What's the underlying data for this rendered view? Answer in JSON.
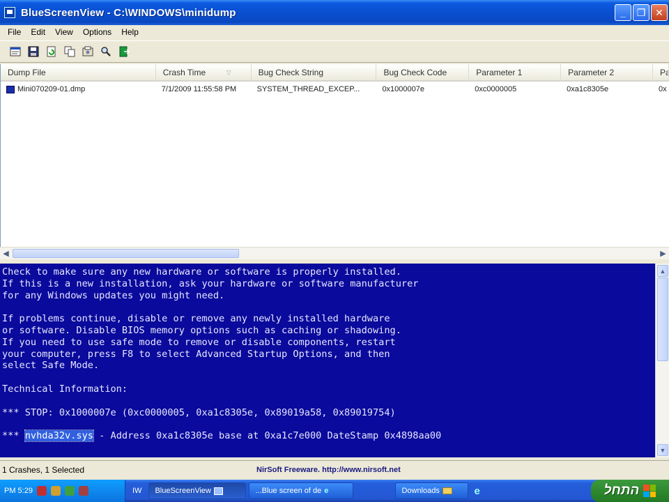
{
  "window": {
    "title": "BlueScreenView  -  C:\\WINDOWS\\minidump",
    "minimize": "_",
    "maximize": "❐",
    "close": "✕"
  },
  "menu": [
    "File",
    "Edit",
    "View",
    "Options",
    "Help"
  ],
  "toolbar": {
    "icons": [
      "properties-icon",
      "save-icon",
      "refresh-icon",
      "copy-icon",
      "options-icon",
      "find-icon",
      "exit-icon"
    ]
  },
  "list": {
    "columns": [
      "Dump File",
      "Crash Time",
      "Bug Check String",
      "Bug Check Code",
      "Parameter 1",
      "Parameter 2",
      "Pa"
    ],
    "rows": [
      [
        "Mini070209-01.dmp",
        "7/1/2009 11:55:58 PM",
        "SYSTEM_THREAD_EXCEP...",
        "0x1000007e",
        "0xc0000005",
        "0xa1c8305e",
        "0x"
      ]
    ]
  },
  "bsod": {
    "lines": [
      "Check to make sure any new hardware or software is properly installed.",
      "If this is a new installation, ask your hardware or software manufacturer",
      "for any Windows updates you might need.",
      "",
      "If problems continue, disable or remove any newly installed hardware",
      "or software. Disable BIOS memory options such as caching or shadowing.",
      "If you need to use safe mode to remove or disable components, restart",
      "your computer, press F8 to select Advanced Startup Options, and then",
      "select Safe Mode.",
      "",
      "Technical Information:",
      "",
      "*** STOP: 0x1000007e (0xc0000005, 0xa1c8305e, 0x89019a58, 0x89019754)",
      ""
    ],
    "driver_prefix": "*** ",
    "driver_name": "nvhda32v.sys",
    "driver_suffix": " - Address 0xa1c8305e base at 0xa1c7e000 DateStamp 0x4898aa00"
  },
  "status": {
    "count": "1 Crashes, 1 Selected",
    "link": "NirSoft Freeware.  http://www.nirsoft.net"
  },
  "taskbar": {
    "clock": "PM 5:29",
    "lang": "IW",
    "tasks": [
      "BlueScreenView",
      "...Blue screen of de",
      "Downloads"
    ],
    "start": "התחל"
  },
  "colors": {
    "bsod_bg": "#0a0a9c",
    "titlebar": "#0a4fd0",
    "start_green": "#2f8a2f"
  }
}
